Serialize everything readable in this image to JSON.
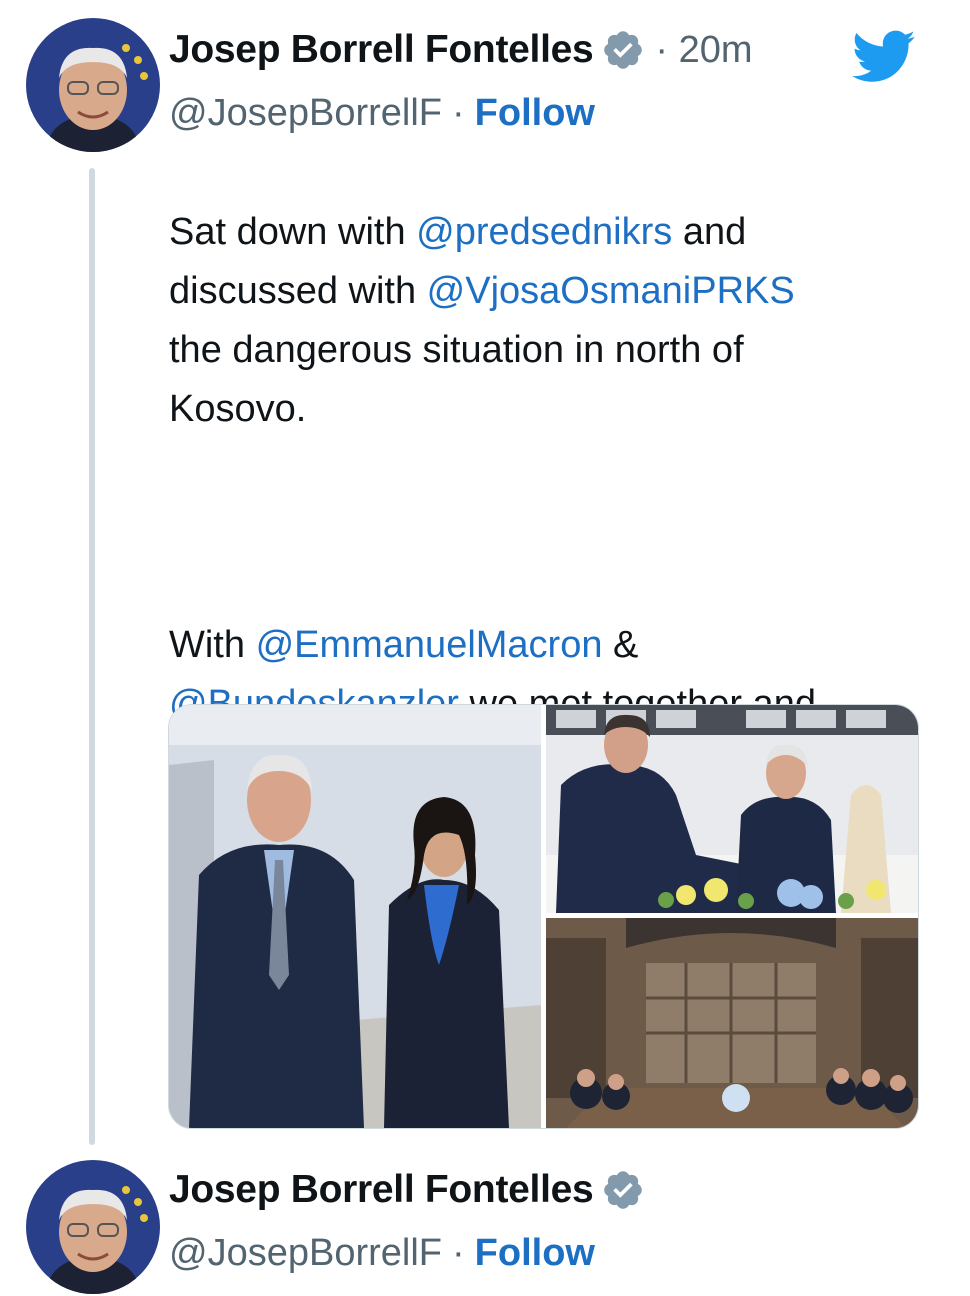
{
  "tweets": [
    {
      "author": {
        "name": "Josep Borrell Fontelles",
        "handle": "@JosepBorrellF",
        "follow_label": "Follow"
      },
      "separator": "·",
      "time": "· 20m",
      "text": {
        "p1": [
          {
            "t": "Sat down with "
          },
          {
            "m": "@predsednikrs"
          },
          {
            "t": " and\ndiscussed with "
          },
          {
            "m": "@VjosaOsmaniPRKS"
          },
          {
            "t": "\nthe dangerous situation in north of\nKosovo."
          }
        ],
        "p2": [
          {
            "t": "With "
          },
          {
            "m": "@EmmanuelMacron"
          },
          {
            "t": " &\n"
          },
          {
            "m": "@Bundeskanzler"
          },
          {
            "t": " we met together and\nbilaterally with President Vucic and\nPresident Osmani."
          }
        ]
      },
      "media_count": 3
    },
    {
      "author": {
        "name": "Josep Borrell Fontelles",
        "handle": "@JosepBorrellF",
        "follow_label": "Follow"
      },
      "separator": "·"
    }
  ],
  "icons": {
    "verified": "verified-badge-icon",
    "twitter": "twitter-bird-icon"
  },
  "colors": {
    "link": "#1d6fc4",
    "verified": "#829aab",
    "twitter": "#1d9bf0",
    "secondary_text": "#536471",
    "thread_line": "#cfd9de"
  }
}
